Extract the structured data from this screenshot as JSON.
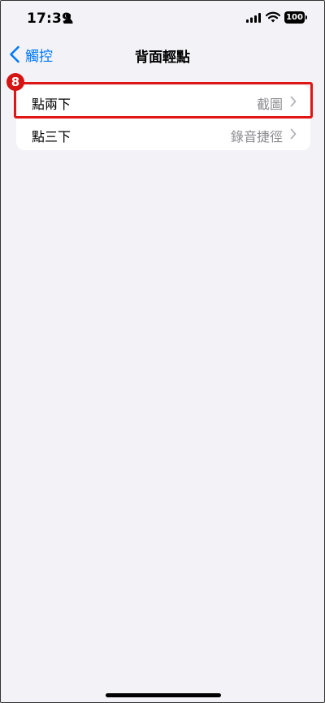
{
  "status_bar": {
    "time": "17:39",
    "battery": "100",
    "icons": [
      "person-icon",
      "cellular-signal-icon",
      "wifi-icon",
      "battery-icon"
    ]
  },
  "nav": {
    "back_label": "觸控",
    "title": "背面輕點"
  },
  "rows": [
    {
      "label": "點兩下",
      "value": "截圖"
    },
    {
      "label": "點三下",
      "value": "錄音捷徑"
    }
  ],
  "annotation": {
    "step": "8",
    "color": "#e01616"
  },
  "colors": {
    "accent": "#007aff",
    "background": "#f2f2f7",
    "secondary_text": "#8a8a8e"
  }
}
